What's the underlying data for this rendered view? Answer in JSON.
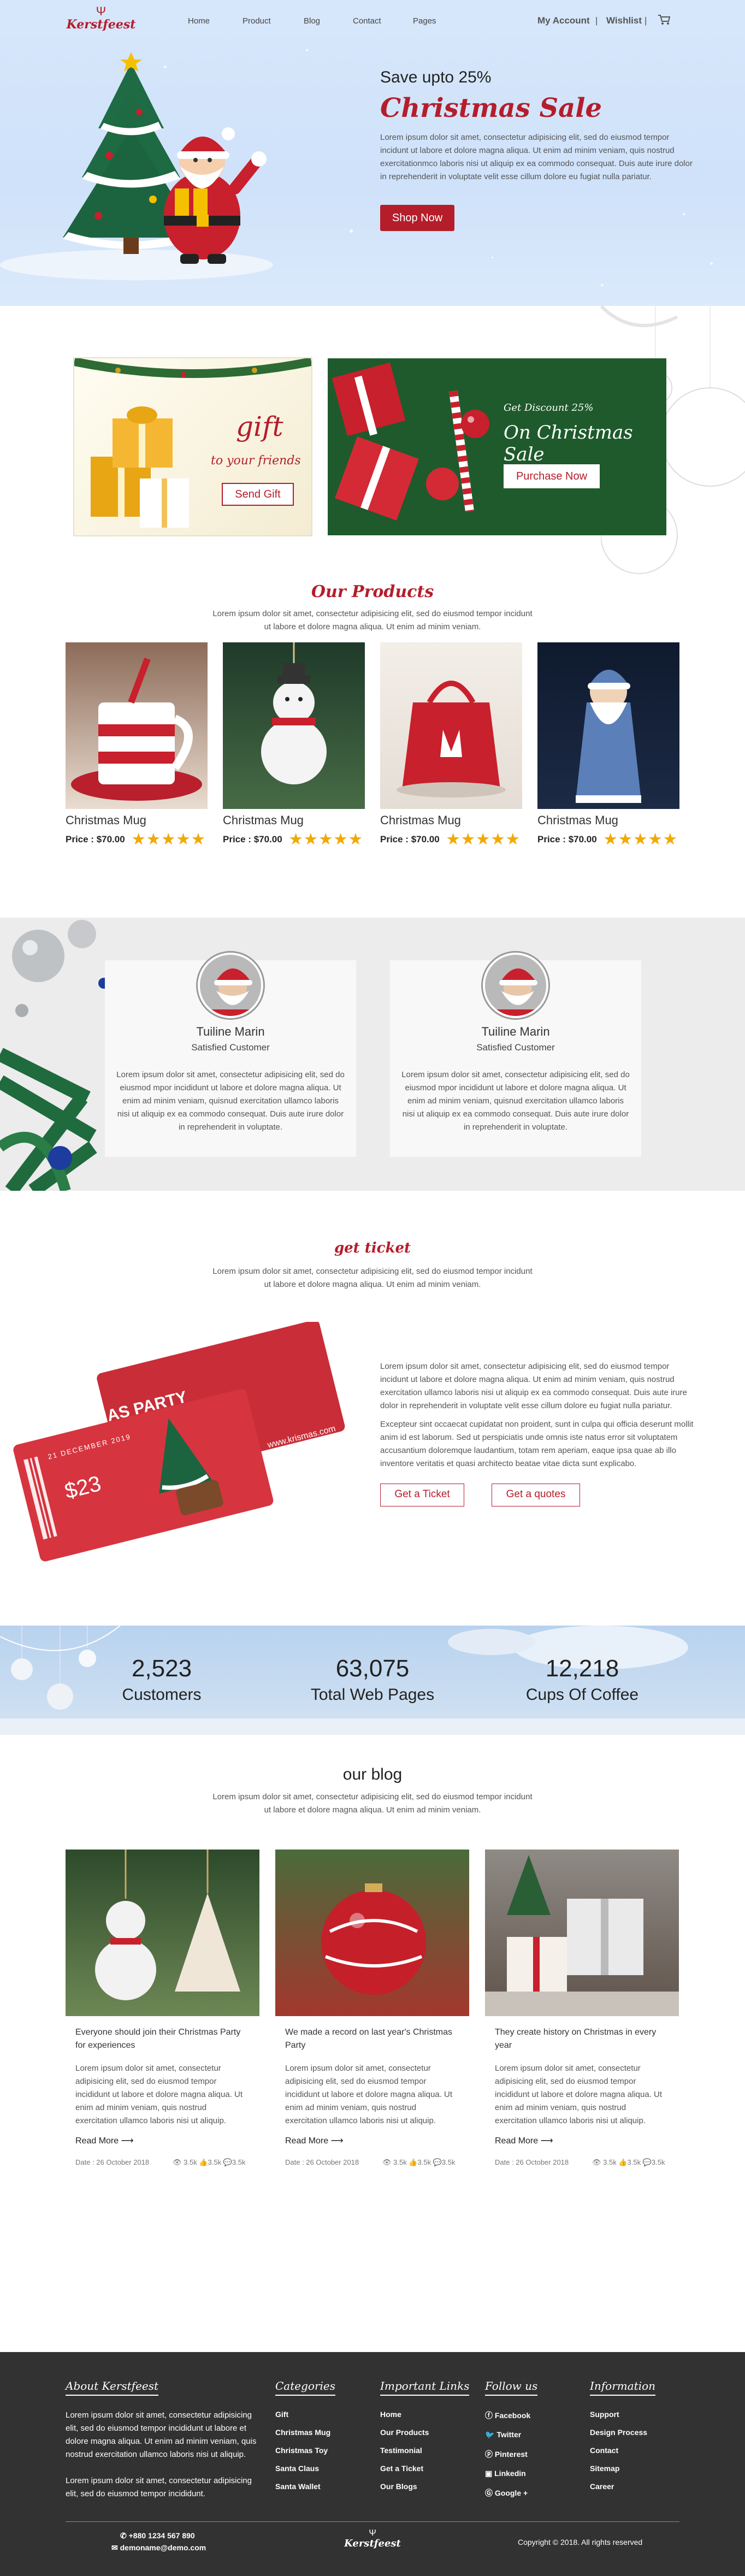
{
  "header": {
    "brand": "Kerstfeest",
    "nav": [
      "Home",
      "Product",
      "Blog",
      "Contact",
      "Pages"
    ],
    "account": "My Account",
    "wishlist": "Wishlist",
    "separator": "|",
    "cart_icon": "cart-icon"
  },
  "hero": {
    "subtitle": "Save upto 25%",
    "title": "Christmas Sale",
    "text": "Lorem ipsum dolor sit amet, consectetur adipisicing elit, sed do eiusmod tempor incidunt ut labore et dolore magna aliqua. Ut enim ad minim veniam, quis nostrud exercitationmco laboris nisi ut aliquip ex ea commodo consequat. Duis aute irure dolor in reprehenderit in voluptate velit esse cillum dolore eu fugiat nulla pariatur.",
    "button": "Shop Now"
  },
  "banners": {
    "gift_word": "gift",
    "gift_line": "to your friends",
    "gift_button": "Send Gift",
    "discount_line": "Get Discount 25%",
    "discount_title": "On Christmas Sale",
    "discount_button": "Purchase Now"
  },
  "products": {
    "title": "Our Products",
    "subtitle": "Lorem ipsum dolor sit amet, consectetur adipisicing elit, sed do eiusmod tempor incidunt ut labore et dolore magna aliqua. Ut enim ad minim veniam.",
    "items": [
      {
        "name": "Christmas Mug",
        "price": "Price : $70.00",
        "rating": 5
      },
      {
        "name": "Christmas Mug",
        "price": "Price : $70.00",
        "rating": 5
      },
      {
        "name": "Christmas Mug",
        "price": "Price : $70.00",
        "rating": 5
      },
      {
        "name": "Christmas Mug",
        "price": "Price : $70.00",
        "rating": 5
      }
    ],
    "stars": "★★★★★"
  },
  "testimonials": [
    {
      "name": "Tuiline Marin",
      "role": "Satisfied Customer",
      "text": "Lorem ipsum dolor sit amet, consectetur adipisicing elit, sed do eiusmod mpor incididunt ut labore et dolore magna aliqua. Ut enim ad minim veniam, quisnud exercitation ullamco laboris nisi ut aliquip ex ea commodo consequat. Duis aute irure dolor in reprehenderit in voluptate."
    },
    {
      "name": "Tuiline Marin",
      "role": "Satisfied Customer",
      "text": "Lorem ipsum dolor sit amet, consectetur adipisicing elit, sed do eiusmod mpor incididunt ut labore et dolore magna aliqua. Ut enim ad minim veniam, quisnud exercitation ullamco laboris nisi ut aliquip ex ea commodo consequat. Duis aute irure dolor in reprehenderit in voluptate."
    }
  ],
  "ticket": {
    "title": "get ticket",
    "subtitle": "Lorem ipsum dolor sit amet, consectetur adipisicing elit, sed do eiusmod tempor incidunt ut labore et dolore magna aliqua. Ut enim ad minim veniam.",
    "p1": "Lorem ipsum dolor sit amet, consectetur adipisicing elit, sed do eiusmod tempor incidunt ut labore et dolore magna aliqua. Ut enim ad minim veniam, quis nostrud exercitation ullamco laboris nisi ut aliquip ex ea commodo consequat. Duis aute irure dolor in reprehenderit in voluptate velit esse cillum dolore eu fugiat nulla pariatur.",
    "p2": "Excepteur sint occaecat cupidatat non proident, sunt in culpa qui officia deserunt mollit anim id est laborum. Sed ut perspiciatis unde omnis iste natus error sit voluptatem accusantium doloremque laudantium, totam rem aperiam, eaque ipsa quae ab illo inventore veritatis et quasi architecto beatae vitae dicta sunt explicabo.",
    "btn_ticket": "Get a Ticket",
    "btn_quotes": "Get a quotes",
    "card": {
      "label": "CHRISTMAS PARTY",
      "date": "21 DECEMBER 2019",
      "price": "$23",
      "url": "www.krismas.com"
    }
  },
  "stats": [
    {
      "value": "2,523",
      "label": "Customers"
    },
    {
      "value": "63,075",
      "label": "Total Web Pages"
    },
    {
      "value": "12,218",
      "label": "Cups Of Coffee"
    }
  ],
  "blog": {
    "title": "our blog",
    "subtitle": "Lorem ipsum dolor sit amet, consectetur adipisicing elit, sed do eiusmod tempor incidunt ut labore et dolore magna aliqua. Ut enim ad minim veniam.",
    "posts": [
      {
        "title": "Everyone should join their Christmas Party for experiences",
        "body": "Lorem ipsum dolor sit amet, consectetur adipisicing elit, sed do eiusmod tempor incididunt ut labore et dolore magna aliqua. Ut enim ad minim veniam, quis nostrud exercitation ullamco laboris nisi ut aliquip.",
        "more": "Read More",
        "date": "Date : 26 October 2018",
        "views": "3.5k",
        "likes": "3.5k",
        "comments": "3.5k"
      },
      {
        "title": "We made a record on last year's Christmas Party",
        "body": "Lorem ipsum dolor sit amet, consectetur adipisicing elit, sed do eiusmod tempor incididunt ut labore et dolore magna aliqua. Ut enim ad minim veniam, quis nostrud exercitation ullamco laboris nisi ut aliquip.",
        "more": "Read More",
        "date": "Date : 26 October 2018",
        "views": "3.5k",
        "likes": "3.5k",
        "comments": "3.5k"
      },
      {
        "title": "They create history on Christmas in every year",
        "body": "Lorem ipsum dolor sit amet, consectetur adipisicing elit, sed do eiusmod tempor incididunt ut labore et dolore magna aliqua. Ut enim ad minim veniam, quis nostrud exercitation ullamco laboris nisi ut aliquip.",
        "more": "Read More",
        "date": "Date : 26 October 2018",
        "views": "3.5k",
        "likes": "3.5k",
        "comments": "3.5k"
      }
    ]
  },
  "footer": {
    "about_title": "About Kerstfeest",
    "about_p1": "Lorem ipsum dolor sit amet, consectetur adipisicing elit, sed do eiusmod tempor incididunt ut labore et dolore magna aliqua. Ut enim ad minim veniam, quis nostrud exercitation ullamco laboris nisi ut aliquip.",
    "about_p2": "Lorem ipsum dolor sit amet, consectetur adipisicing elit, sed do eiusmod tempor incididunt.",
    "categories_title": "Categories",
    "categories": [
      "Gift",
      "Christmas Mug",
      "Christmas Toy",
      "Santa Claus",
      "Santa Wallet"
    ],
    "links_title": "Important Links",
    "links": [
      "Home",
      "Our Products",
      "Testimonial",
      "Get a Ticket",
      "Our Blogs"
    ],
    "follow_title": "Follow us",
    "follow": [
      "Facebook",
      "Twitter",
      "Pinterest",
      "Linkedin",
      "Google +"
    ],
    "info_title": "Information",
    "info": [
      "Support",
      "Design Process",
      "Contact",
      "Sitemap",
      "Career"
    ],
    "phone": "+880 1234 567 890",
    "email": "demoname@demo.com",
    "brand": "Kerstfeest",
    "copyright": "Copyright © 2018. All rights reserved"
  },
  "colors": {
    "accent": "#b51d2b",
    "footer_bg": "#323232",
    "hero_bg": "#d7e7fb",
    "star": "#f2a900"
  }
}
